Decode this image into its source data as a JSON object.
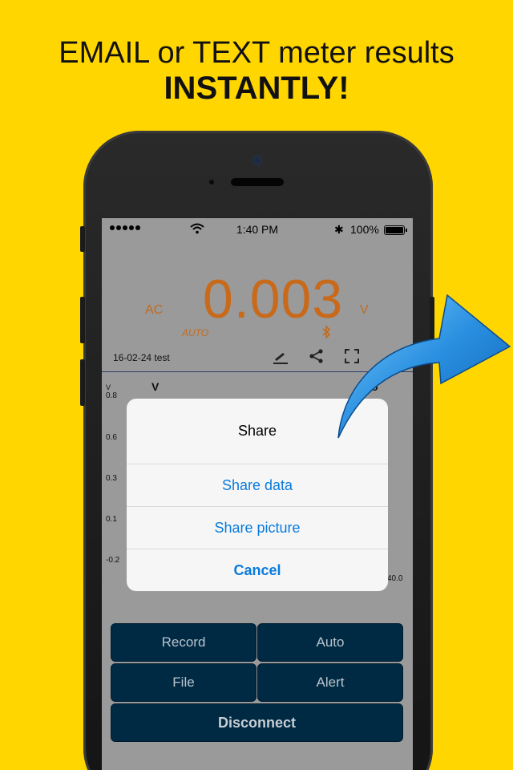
{
  "headline": {
    "line1": "EMAIL or TEXT meter results",
    "line2": "INSTANTLY!"
  },
  "statusbar": {
    "time": "1:40 PM",
    "battery": "100%"
  },
  "meter": {
    "mode": "AC",
    "value": "0.003",
    "unit": "V",
    "range": "AUTO",
    "file": "16-02-24 test"
  },
  "chart_data": {
    "type": "line",
    "ylabel": "V",
    "series_label": "V",
    "right_label": "No",
    "y_ticks": [
      "0.8",
      "0.6",
      "0.3",
      "0.1",
      "-0.2"
    ],
    "x_end": "40.0"
  },
  "buttons": {
    "record": "Record",
    "auto": "Auto",
    "file": "File",
    "alert": "Alert",
    "disconnect": "Disconnect"
  },
  "dialog": {
    "title": "Share",
    "share_data": "Share data",
    "share_picture": "Share picture",
    "cancel": "Cancel"
  },
  "colors": {
    "background": "#ffd600",
    "reading": "#c9691a",
    "button": "#002a44",
    "link": "#0a7bdc"
  }
}
